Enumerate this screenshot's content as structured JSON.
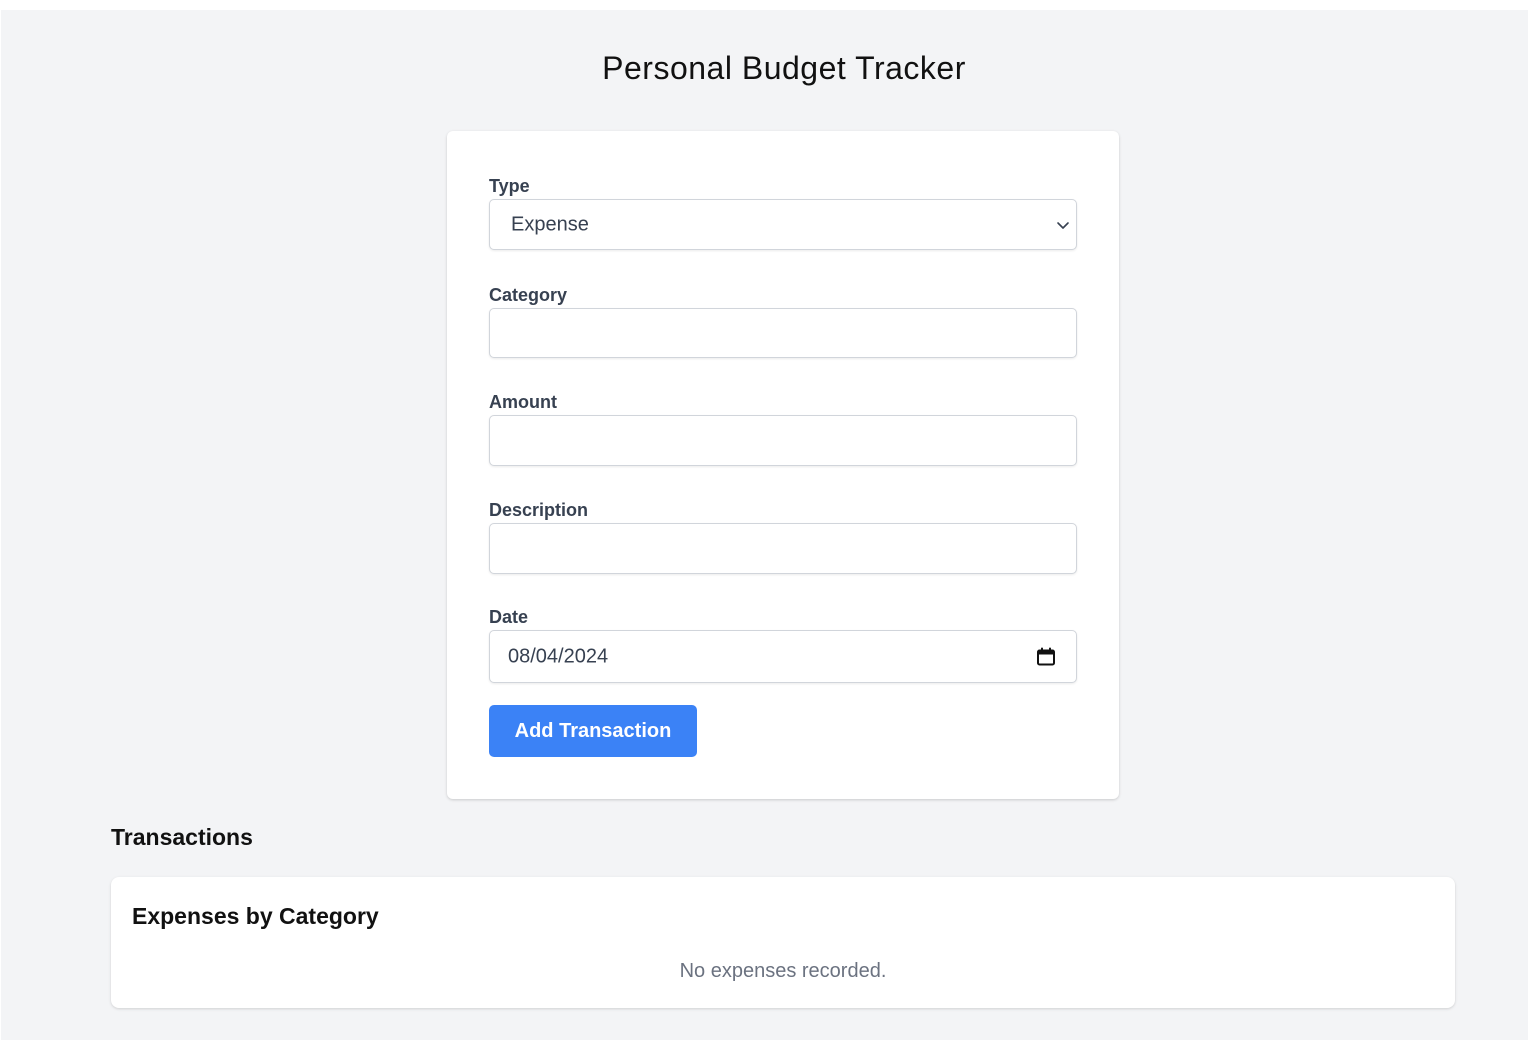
{
  "app": {
    "title": "Personal Budget Tracker"
  },
  "form": {
    "type": {
      "label": "Type",
      "value": "Expense",
      "icon": "chevron-down-icon"
    },
    "category": {
      "label": "Category",
      "value": ""
    },
    "amount": {
      "label": "Amount",
      "value": ""
    },
    "description": {
      "label": "Description",
      "value": ""
    },
    "date": {
      "label": "Date",
      "value": "08/04/2024",
      "icon": "calendar-icon"
    },
    "submit_label": "Add Transaction"
  },
  "transactions": {
    "heading": "Transactions"
  },
  "expenses_by_category": {
    "heading": "Expenses by Category",
    "empty_message": "No expenses recorded."
  },
  "colors": {
    "page_background": "#f3f4f6",
    "card_background": "#ffffff",
    "accent": "#3b82f6",
    "label_text": "#374151",
    "muted_text": "#6b7280"
  }
}
